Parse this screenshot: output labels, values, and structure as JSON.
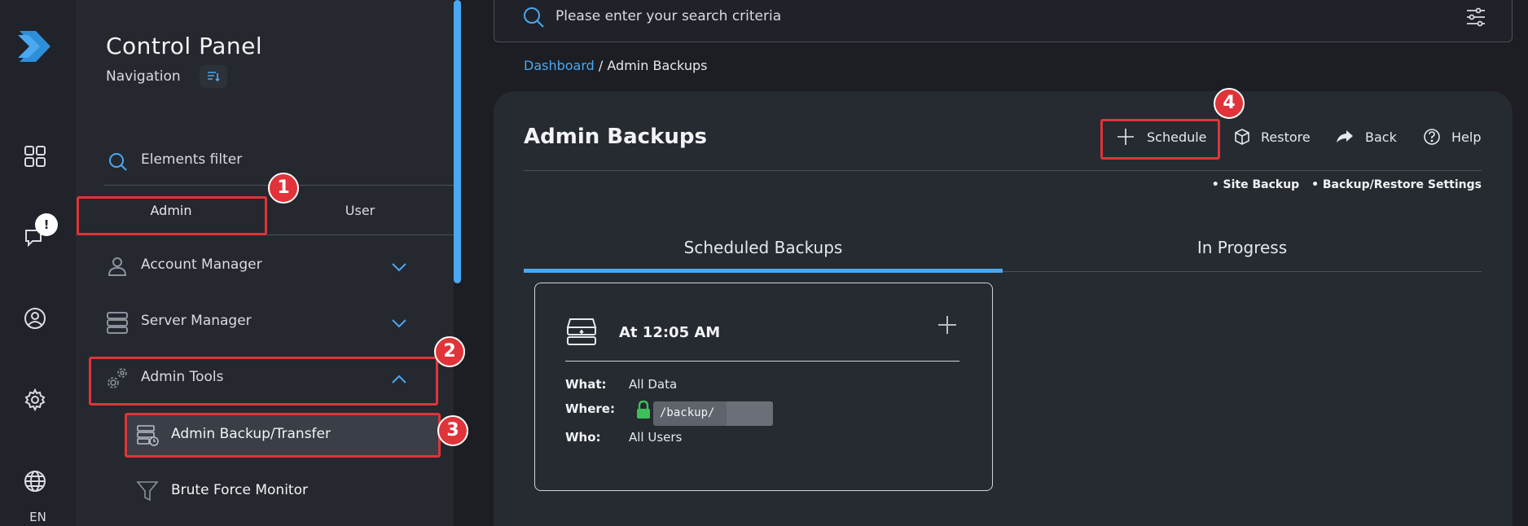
{
  "rail": {
    "notification_badge": "!",
    "language": "EN"
  },
  "sidebar": {
    "title": "Control Panel",
    "subtitle": "Navigation",
    "filter_label": "Elements filter",
    "tabs": [
      {
        "label": "Admin",
        "active": true
      },
      {
        "label": "User",
        "active": false
      }
    ],
    "menu": [
      {
        "label": "Account Manager",
        "icon": "user-icon",
        "expanded": false
      },
      {
        "label": "Server Manager",
        "icon": "server-icon",
        "expanded": false
      },
      {
        "label": "Admin Tools",
        "icon": "gears-icon",
        "expanded": true
      }
    ],
    "submenu": [
      {
        "label": "Admin Backup/Transfer",
        "icon": "backup-icon",
        "active": true
      },
      {
        "label": "Brute Force Monitor",
        "icon": "funnel-icon",
        "active": false
      }
    ]
  },
  "search": {
    "placeholder": "Please enter your search criteria"
  },
  "breadcrumb": {
    "link": "Dashboard",
    "separator": "/",
    "current": "Admin Backups"
  },
  "page": {
    "title": "Admin Backups",
    "actions": {
      "schedule": "Schedule",
      "restore": "Restore",
      "back": "Back",
      "help": "Help"
    },
    "links": [
      "• Site Backup",
      "• Backup/Restore Settings"
    ],
    "tabs": [
      {
        "label": "Scheduled Backups",
        "active": true
      },
      {
        "label": "In Progress",
        "active": false
      }
    ]
  },
  "backup_card": {
    "time": "At 12:05 AM",
    "what_label": "What:",
    "what_value": "All Data",
    "where_label": "Where:",
    "where_value": "/backup/",
    "who_label": "Who:",
    "who_value": "All Users"
  },
  "annotations": [
    "1",
    "2",
    "3",
    "4"
  ],
  "colors": {
    "accent": "#4aa8f0",
    "annotation_red": "#e0343a",
    "lock_green": "#3fbf5a"
  }
}
